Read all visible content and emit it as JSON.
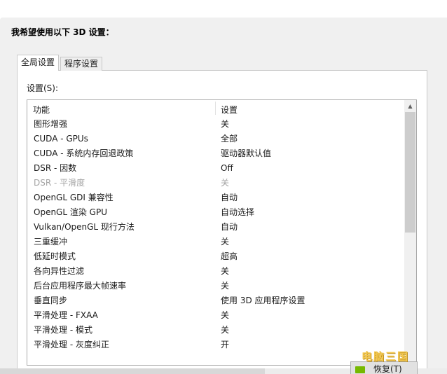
{
  "heading": "我希望使用以下 3D 设置：",
  "tabs": [
    {
      "label": "全局设置",
      "active": true
    },
    {
      "label": "程序设置",
      "active": false
    }
  ],
  "settings_label": "设置(S):",
  "columns": {
    "feature": "功能",
    "setting": "设置"
  },
  "rows": [
    {
      "feature": "图形增强",
      "value": "关"
    },
    {
      "feature": "CUDA - GPUs",
      "value": "全部"
    },
    {
      "feature": "CUDA - 系统内存回退政策",
      "value": "驱动器默认值"
    },
    {
      "feature": "DSR - 因数",
      "value": "Off"
    },
    {
      "feature": "DSR - 平滑度",
      "value": "关"
    },
    {
      "feature": "OpenGL GDI 兼容性",
      "value": "自动"
    },
    {
      "feature": "OpenGL 渲染 GPU",
      "value": "自动选择"
    },
    {
      "feature": "Vulkan/OpenGL 现行方法",
      "value": "自动"
    },
    {
      "feature": "三重缓冲",
      "value": "关"
    },
    {
      "feature": "低延时模式",
      "value": "超高"
    },
    {
      "feature": "各向异性过滤",
      "value": "关"
    },
    {
      "feature": "后台应用程序最大帧速率",
      "value": "关"
    },
    {
      "feature": "垂直同步",
      "value": "使用 3D 应用程序设置"
    },
    {
      "feature": "平滑处理 - FXAA",
      "value": "关"
    },
    {
      "feature": "平滑处理 - 模式",
      "value": "关"
    },
    {
      "feature": "平滑处理 - 灰度纠正",
      "value": "开"
    }
  ],
  "restore_button": "恢复(T)",
  "watermark": "电脑三国",
  "colors": {
    "nvidia_green": "#76b900",
    "disabled_text": "#a3a3a3",
    "panel_bg": "#f0f0f0"
  }
}
